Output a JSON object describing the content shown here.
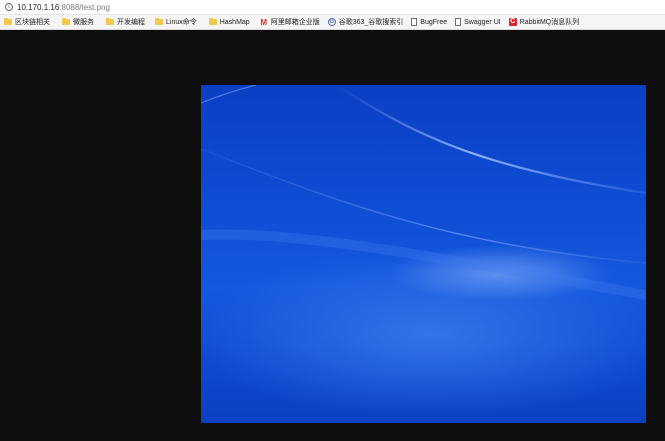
{
  "browser": {
    "url_host": "10.170.1.16",
    "url_path": ":8088/test.png"
  },
  "bookmarks": [
    {
      "label": "区块链相关",
      "icon": "folder-icon"
    },
    {
      "label": "微服务",
      "icon": "folder-icon"
    },
    {
      "label": "开发编程",
      "icon": "folder-icon"
    },
    {
      "label": "Linux命令",
      "icon": "folder-icon"
    },
    {
      "label": "HashMap",
      "icon": "folder-icon"
    },
    {
      "label": "阿里邮箱企业版",
      "icon": "gmail-icon"
    },
    {
      "label": "谷歌363_谷歌搜索引",
      "icon": "google-icon"
    },
    {
      "label": "BugFree",
      "icon": "page-icon"
    },
    {
      "label": "Swagger UI",
      "icon": "page-icon"
    },
    {
      "label": "RabbitMQ消息队列",
      "icon": "rabbitmq-icon"
    }
  ],
  "colors": {
    "page_background": "#0e0e0e",
    "wallpaper_blue": "#0f4fd6"
  }
}
